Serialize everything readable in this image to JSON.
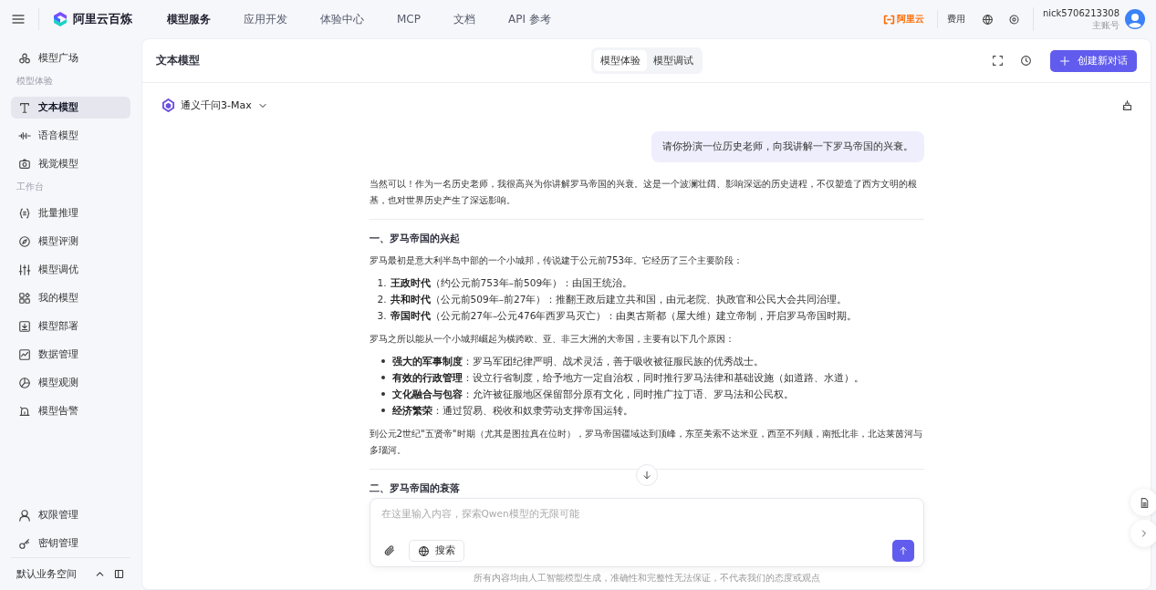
{
  "topbar": {
    "brand": "阿里云百炼",
    "nav": [
      {
        "label": "模型服务",
        "selected": true
      },
      {
        "label": "应用开发",
        "selected": false
      },
      {
        "label": "体验中心",
        "selected": false
      },
      {
        "label": "MCP",
        "selected": false
      },
      {
        "label": "文档",
        "selected": false
      },
      {
        "label": "API 参考",
        "selected": false
      }
    ],
    "cloud_logo": "阿里云",
    "billing": "费用",
    "username": "nick5706213308",
    "account_type": "主账号"
  },
  "sidebar": {
    "top_items": [
      {
        "label": "模型广场",
        "selected": false
      }
    ],
    "sections": [
      {
        "title": "模型体验",
        "items": [
          {
            "label": "文本模型",
            "selected": true
          },
          {
            "label": "语音模型",
            "selected": false
          },
          {
            "label": "视觉模型",
            "selected": false
          }
        ]
      },
      {
        "title": "工作台",
        "items": [
          {
            "label": "批量推理",
            "selected": false
          },
          {
            "label": "模型评测",
            "selected": false
          },
          {
            "label": "模型调优",
            "selected": false
          },
          {
            "label": "我的模型",
            "selected": false
          },
          {
            "label": "模型部署",
            "selected": false
          },
          {
            "label": "数据管理",
            "selected": false
          },
          {
            "label": "模型观测",
            "selected": false
          },
          {
            "label": "模型告警",
            "selected": false
          }
        ]
      }
    ],
    "bottom_items": [
      {
        "label": "权限管理",
        "selected": false
      },
      {
        "label": "密钥管理",
        "selected": false
      }
    ],
    "workspace": "默认业务空间"
  },
  "panel": {
    "title": "文本模型",
    "tabs": [
      {
        "label": "模型体验",
        "selected": true
      },
      {
        "label": "模型调试",
        "selected": false
      }
    ],
    "new_chat_button": "创建新对话",
    "model": "通义千问3-Max",
    "user_message": "请你扮演一位历史老师，向我讲解一下罗马帝国的兴衰。",
    "response": [
      {
        "kind": "paragraph",
        "text": "当然可以！作为一名历史老师，我很高兴为你讲解罗马帝国的兴衰。这是一个波澜壮阔、影响深远的历史进程，不仅塑造了西方文明的根基，也对世界历史产生了深远影响。"
      },
      {
        "kind": "rule"
      },
      {
        "kind": "heading",
        "text": "一、罗马帝国的兴起"
      },
      {
        "kind": "paragraph",
        "text": "罗马最初是意大利半岛中部的一个小城邦，传说建于公元前753年。它经历了三个主要阶段："
      },
      {
        "kind": "ordered_list",
        "items": [
          {
            "number": "1.",
            "text": "**王政时代**（约公元前753年–前509年）：由国王统治。"
          },
          {
            "number": "2.",
            "text": "**共和时代**（公元前509年–前27年）：推翻王政后建立共和国，由元老院、执政官和公民大会共同治理。"
          },
          {
            "number": "3.",
            "text": "**帝国时代**（公元前27年–公元476年西罗马灭亡）：由奥古斯都（屋大维）建立帝制，开启罗马帝国时期。"
          }
        ]
      },
      {
        "kind": "paragraph",
        "text": "罗马之所以能从一个小城邦崛起为横跨欧、亚、非三大洲的大帝国，主要有以下几个原因："
      },
      {
        "kind": "bullet_list",
        "items": [
          {
            "text": "**强大的军事制度**：罗马军团纪律严明、战术灵活，善于吸收被征服民族的优秀战士。"
          },
          {
            "text": "**有效的行政管理**：设立行省制度，给予地方一定自治权，同时推行罗马法律和基础设施（如道路、水道）。"
          },
          {
            "text": "**文化融合与包容**：允许被征服地区保留部分原有文化，同时推广拉丁语、罗马法和公民权。"
          },
          {
            "text": "**经济繁荣**：通过贸易、税收和奴隶劳动支撑帝国运转。"
          }
        ]
      },
      {
        "kind": "paragraph",
        "text": "到公元2世纪\"五贤帝\"时期（尤其是图拉真在位时），罗马帝国疆域达到顶峰，东至美索不达米亚，西至不列颠，南抵北非，北达莱茵河与多瑙河。"
      },
      {
        "kind": "rule"
      },
      {
        "kind": "heading",
        "text": "二、罗马帝国的衰落"
      }
    ],
    "input_placeholder": "在这里输入内容，探索Qwen模型的无限可能",
    "search_button": "搜索",
    "disclaimer": "所有内容均由人工智能模型生成，准确性和完整性无法保证，不代表我们的态度或观点"
  }
}
